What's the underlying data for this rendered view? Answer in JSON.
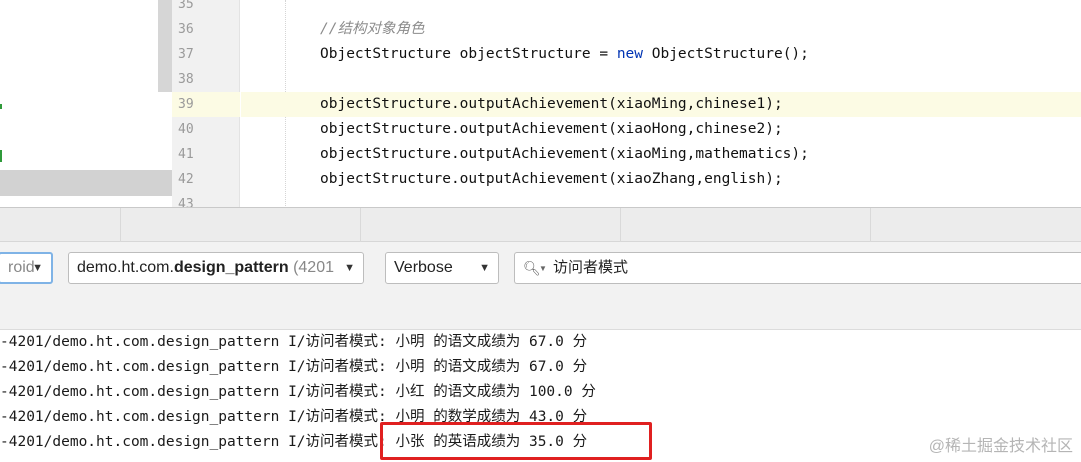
{
  "editor": {
    "line_numbers": [
      "35",
      "36",
      "37",
      "38",
      "39",
      "40",
      "41",
      "42",
      "43"
    ],
    "code": {
      "comment": "//结构对象角色",
      "decl_left": "ObjectStructure objectStructure = ",
      "decl_keyword": "new",
      "decl_right": " ObjectStructure();",
      "call1": "objectStructure.outputAchievement(xiaoMing,chinese1);",
      "call2": "objectStructure.outputAchievement(xiaoHong,chinese2);",
      "call3": "objectStructure.outputAchievement(xiaoMing,mathematics);",
      "call4": "objectStructure.outputAchievement(xiaoZhang,english);"
    }
  },
  "logcat": {
    "device_combo": "roid",
    "process_combo_prefix": "demo.ht.com.",
    "process_combo_bold": "design_pattern",
    "process_combo_pid": " (4201",
    "level_combo": "Verbose",
    "search_query": "访问者模式",
    "lines": [
      "-4201/demo.ht.com.design_pattern I/访问者模式: 小明 的语文成绩为 67.0 分",
      "-4201/demo.ht.com.design_pattern I/访问者模式: 小明 的语文成绩为 67.0 分",
      "-4201/demo.ht.com.design_pattern I/访问者模式: 小红 的语文成绩为 100.0 分",
      "-4201/demo.ht.com.design_pattern I/访问者模式: 小明 的数学成绩为 43.0 分",
      "-4201/demo.ht.com.design_pattern I/访问者模式: 小张 的英语成绩为 35.0 分"
    ]
  },
  "watermark": "@稀土掘金技术社区",
  "colors": {
    "keyword": "#0033b3",
    "comment": "#8c8c8c",
    "highlight_box": "#e02020",
    "current_line": "#fcfbe4"
  },
  "icons": [
    "search-icon",
    "dropdown-arrow-icon"
  ]
}
